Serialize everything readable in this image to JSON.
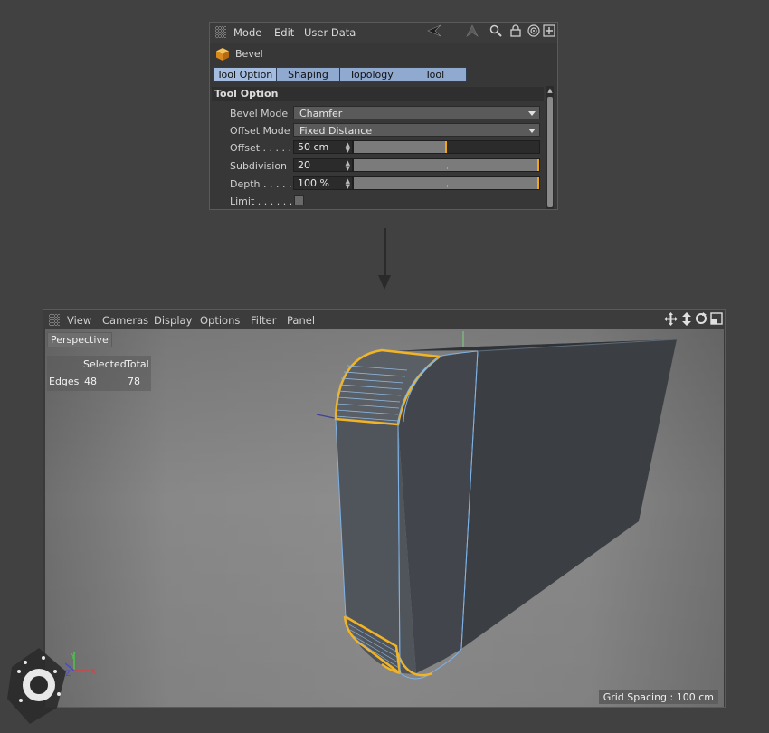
{
  "attribute_panel": {
    "menu": [
      "Mode",
      "Edit",
      "User Data"
    ],
    "toolbar_icons": [
      "arrow-left-icon",
      "arrow-up-icon",
      "search-icon",
      "lock-icon",
      "target-icon",
      "new-panel-icon"
    ],
    "object_name": "Bevel",
    "tabs": [
      {
        "label": "Tool Option",
        "active": true
      },
      {
        "label": "Shaping",
        "active": false
      },
      {
        "label": "Topology",
        "active": false
      },
      {
        "label": "Tool",
        "active": false
      }
    ],
    "section_title": "Tool Option",
    "rows": {
      "bevel_mode": {
        "label": "Bevel Mode",
        "value": "Chamfer"
      },
      "offset_mode": {
        "label": "Offset Mode",
        "value": "Fixed Distance"
      },
      "offset": {
        "label": "Offset . . . . . .",
        "value": "50 cm",
        "slider_level": 0.5
      },
      "subdivision": {
        "label": "Subdivision",
        "value": "20",
        "slider_level": 1.0
      },
      "depth": {
        "label": "Depth . . . . . .",
        "value": "100 %",
        "slider_level": 1.0
      },
      "limit": {
        "label": "Limit . . . . . . .",
        "checked": false
      }
    }
  },
  "viewport": {
    "menu": [
      "View",
      "Cameras",
      "Display",
      "Options",
      "Filter",
      "Panel"
    ],
    "nav_icons": [
      "move-view-icon",
      "zoom-view-icon",
      "rotate-view-icon",
      "maximize-view-icon"
    ],
    "camera_label": "Perspective",
    "hud": {
      "header_selected": "Selected",
      "header_total": "Total",
      "row_label": "Edges",
      "selected": "48",
      "total": "78"
    },
    "grid_spacing": "Grid Spacing : 100 cm",
    "axis_labels": {
      "x": "X",
      "y": "Y",
      "z": "Z"
    }
  },
  "colors": {
    "tab_blue": "#8fa9cf",
    "selection_orange": "#f2a71b",
    "object_dark": "#3e4247",
    "edge_blue": "#7fb2e5"
  }
}
